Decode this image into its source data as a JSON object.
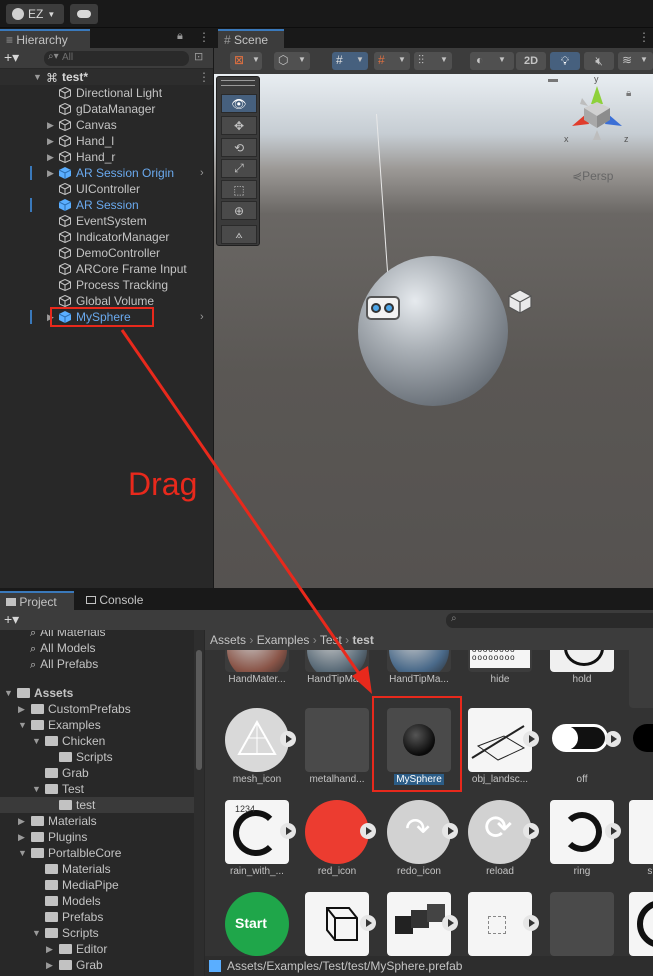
{
  "topbar": {
    "account": "EZ",
    "cloud_icon": "cloud-icon"
  },
  "hierarchy": {
    "tab_label": "Hierarchy",
    "search_placeholder": "All",
    "scene_name": "test*",
    "items": [
      {
        "label": "Directional Light",
        "expandable": false,
        "blue": false
      },
      {
        "label": "gDataManager",
        "expandable": false,
        "blue": false
      },
      {
        "label": "Canvas",
        "expandable": true,
        "blue": false
      },
      {
        "label": "Hand_l",
        "expandable": true,
        "blue": false
      },
      {
        "label": "Hand_r",
        "expandable": true,
        "blue": false
      },
      {
        "label": "AR Session Origin",
        "expandable": true,
        "blue": true
      },
      {
        "label": "UIController",
        "expandable": false,
        "blue": false
      },
      {
        "label": "AR Session",
        "expandable": false,
        "blue": true
      },
      {
        "label": "EventSystem",
        "expandable": false,
        "blue": false
      },
      {
        "label": "IndicatorManager",
        "expandable": false,
        "blue": false
      },
      {
        "label": "DemoController",
        "expandable": false,
        "blue": false
      },
      {
        "label": "ARCore Frame Input",
        "expandable": false,
        "blue": false
      },
      {
        "label": "Process Tracking",
        "expandable": false,
        "blue": false
      },
      {
        "label": "Global Volume",
        "expandable": false,
        "blue": false
      },
      {
        "label": "MySphere",
        "expandable": true,
        "blue": true
      }
    ]
  },
  "scene": {
    "tab_label": "Scene",
    "toggle_2d": "2D",
    "persp_label": "Persp",
    "gizmo_labels": {
      "y": "y",
      "x": "x",
      "z": "z"
    }
  },
  "annotation": {
    "text": "Drag",
    "color": "#e8291c"
  },
  "project": {
    "tabs": {
      "project": "Project",
      "console": "Console"
    },
    "favorites": [
      "All Materials",
      "All Models",
      "All Prefabs"
    ],
    "tree": [
      {
        "label": "Assets",
        "depth": 0,
        "bold": true
      },
      {
        "label": "CustomPrefabs",
        "depth": 1
      },
      {
        "label": "Examples",
        "depth": 1
      },
      {
        "label": "Chicken",
        "depth": 2
      },
      {
        "label": "Scripts",
        "depth": 3
      },
      {
        "label": "Grab",
        "depth": 2
      },
      {
        "label": "Test",
        "depth": 2
      },
      {
        "label": "test",
        "depth": 3,
        "selected": true
      },
      {
        "label": "Materials",
        "depth": 1
      },
      {
        "label": "Plugins",
        "depth": 1
      },
      {
        "label": "PortalbleCore",
        "depth": 1
      },
      {
        "label": "Materials",
        "depth": 2
      },
      {
        "label": "MediaPipe",
        "depth": 2
      },
      {
        "label": "Models",
        "depth": 2
      },
      {
        "label": "Prefabs",
        "depth": 2
      },
      {
        "label": "Scripts",
        "depth": 2
      },
      {
        "label": "Editor",
        "depth": 3
      },
      {
        "label": "Grab",
        "depth": 3
      }
    ],
    "breadcrumb": [
      "Assets",
      "Examples",
      "Test",
      "test"
    ],
    "assets_row1": [
      "HandMater...",
      "HandTipMa...",
      "HandTipMa...",
      "hide",
      "hold",
      ""
    ],
    "assets_row2": [
      "mesh_icon",
      "metalhand...",
      "MySphere",
      "obj_landsc...",
      "off",
      ""
    ],
    "assets_row3": [
      "rain_with_...",
      "red_icon",
      "redo_icon",
      "reload",
      "ring",
      "shado"
    ],
    "assets_row4": [
      "Start",
      "",
      "",
      "",
      "",
      ""
    ],
    "status_path": "Assets/Examples/Test/test/MySphere.prefab"
  }
}
